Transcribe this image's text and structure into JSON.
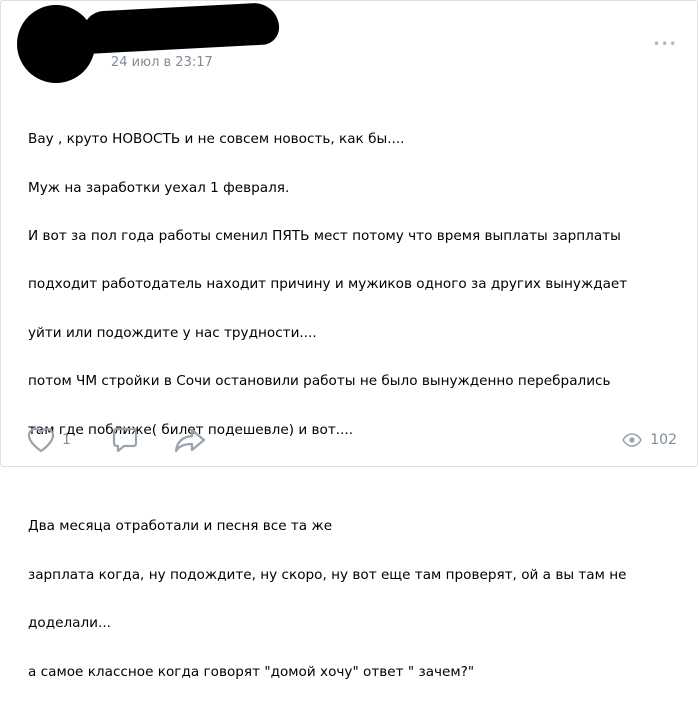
{
  "post": {
    "date": "24 июл в 23:17",
    "more_label": "•••",
    "text_lines": [
      "Вау , круто НОВОСТЬ и не совсем новость, как бы....",
      "Муж на заработки уехал 1 февраля.",
      "И вот за пол года работы сменил ПЯТЬ мест потому что время выплаты зарплаты",
      "подходит работодатель находит причину и мужиков одного за других вынуждает",
      "уйти или подождите у нас трудности....",
      "потом ЧМ стройки в Сочи остановили работы не было вынужденно перебрались",
      "там где поближе( билет подешевле) и вот....",
      "",
      "Два месяца отработали и песня все та же",
      "зарплата когда, ну подождите, ну скоро, ну вот еще там проверят, ой а вы там не",
      "доделали...",
      "а самое классное когда говорят \"домой хочу\" ответ \" зачем?\""
    ]
  },
  "actions": {
    "like_count": "1",
    "views_count": "102"
  },
  "icons": {
    "like": "heart-icon",
    "comment": "comment-icon",
    "share": "share-icon",
    "views": "eye-icon"
  },
  "colors": {
    "icon": "#99a2ad",
    "meta_text": "#818c99"
  }
}
